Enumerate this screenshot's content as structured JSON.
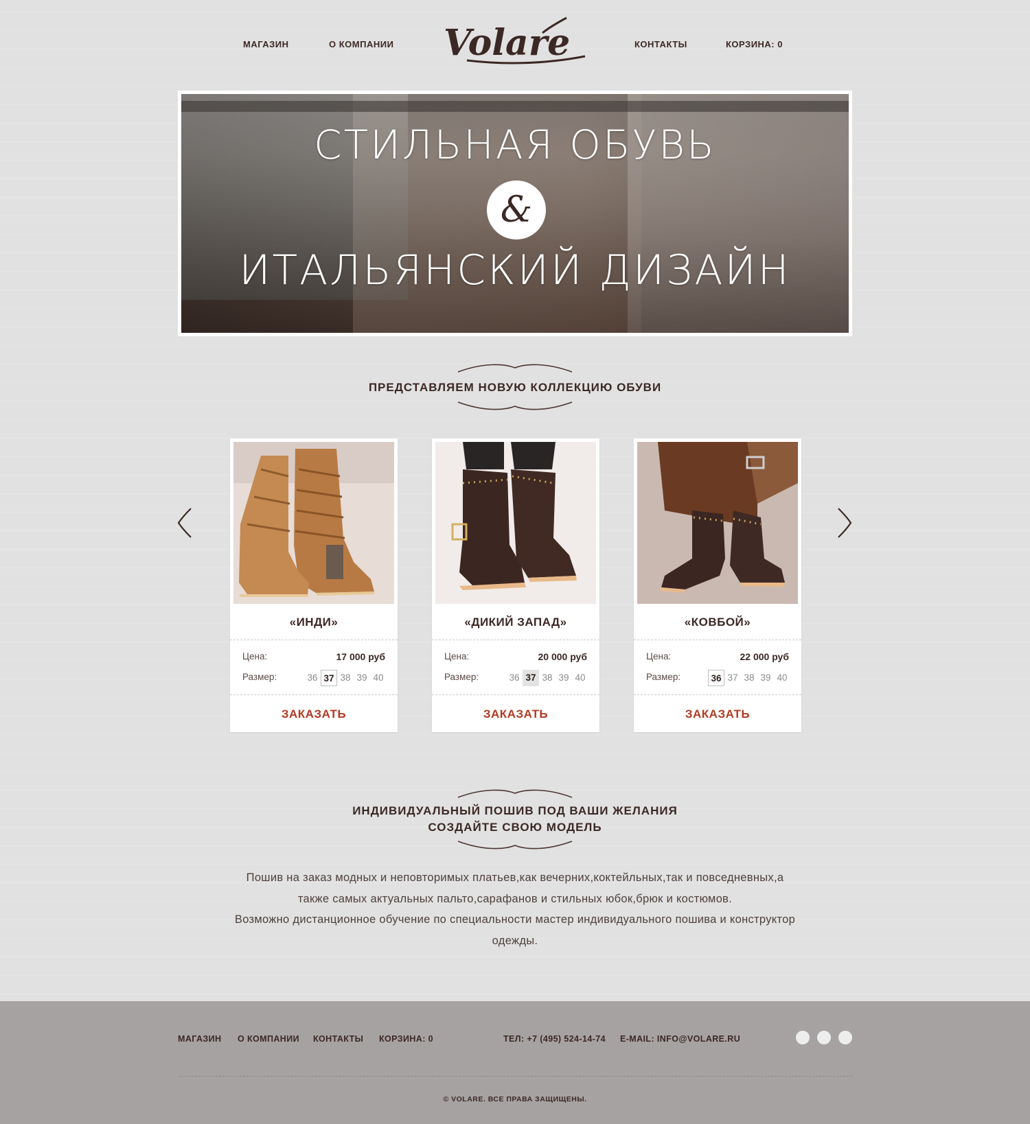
{
  "header": {
    "nav_left": [
      "МАГАЗИН",
      "О КОМПАНИИ"
    ],
    "nav_right": [
      "КОНТАКТЫ",
      "КОРЗИНА: 0"
    ],
    "logo_text": "Volare"
  },
  "hero": {
    "line1": "СТИЛЬНАЯ ОБУВЬ",
    "ampersand": "&",
    "line2": "ИТАЛЬЯНСКИЙ ДИЗАЙН"
  },
  "collection": {
    "title": "ПРЕДСТАВЛЯЕМ НОВУЮ КОЛЛЕКЦИЮ ОБУВИ",
    "price_label": "Цена:",
    "size_label": "Размер:",
    "order_label": "ЗАКАЗАТЬ",
    "products": [
      {
        "name": "«ИНДИ»",
        "price": "17 000 руб",
        "sizes": [
          "36",
          "37",
          "38",
          "39",
          "40"
        ],
        "selected": "37"
      },
      {
        "name": "«ДИКИЙ ЗАПАД»",
        "price": "20 000 руб",
        "sizes": [
          "36",
          "37",
          "38",
          "39",
          "40"
        ],
        "selected": "37"
      },
      {
        "name": "«КОВБОЙ»",
        "price": "22 000 руб",
        "sizes": [
          "36",
          "37",
          "38",
          "39",
          "40"
        ],
        "selected": "36"
      }
    ]
  },
  "custom": {
    "title_line1": "ИНДИВИДУАЛЬНЫЙ ПОШИВ ПОД ВАШИ ЖЕЛАНИЯ",
    "title_line2": "СОЗДАЙТЕ СВОЮ МОДЕЛЬ",
    "para1": "Пошив на заказ модных и неповторимых платьев,как вечерних,коктейльных,так и повседневных,а также самых актуальных пальто,сарафанов и стильных юбок,брюк и костюмов.",
    "para2": "Возможно дистанционное обучение по специальности мастер индивидуального пошива и конструктор одежды."
  },
  "footer": {
    "nav": [
      "МАГАЗИН",
      "О КОМПАНИИ",
      "КОНТАКТЫ",
      "КОРЗИНА: 0"
    ],
    "phone": "ТЕЛ: +7 (495) 524-14-74",
    "email": "E-MAIL: INFO@VOLARE.RU",
    "copyright": "© VOLARE. ВСЕ ПРАВА ЗАЩИЩЕНЫ."
  },
  "colors": {
    "background": "#e1e1e1",
    "text_brown": "#3b2824",
    "accent_red": "#b03a22",
    "footer_bg": "#a6a2a1"
  }
}
